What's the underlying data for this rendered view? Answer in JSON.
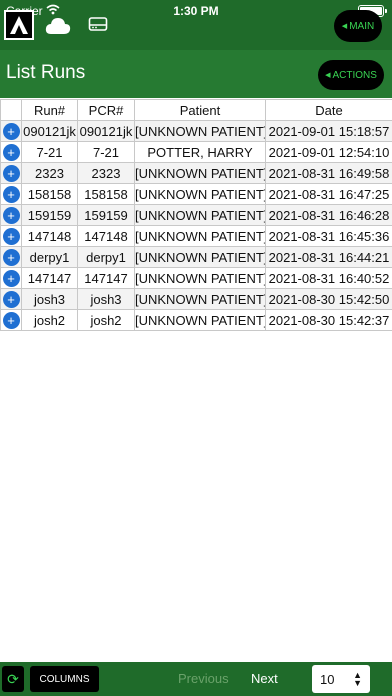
{
  "status_bar": {
    "carrier": "Carrier",
    "time": "1:30 PM"
  },
  "top_bar": {
    "main_label": "MAIN"
  },
  "page": {
    "title": "List Runs",
    "actions_label": "ACTIONS"
  },
  "table": {
    "headers": [
      "",
      "Run#",
      "PCR#",
      "Patient",
      "Date"
    ],
    "rows": [
      {
        "run": "090121jk",
        "pcr": "090121jk",
        "patient": "[UNKNOWN PATIENT]",
        "date": "2021-09-01 15:18:57"
      },
      {
        "run": "7-21",
        "pcr": "7-21",
        "patient": "POTTER, HARRY",
        "date": "2021-09-01 12:54:10"
      },
      {
        "run": "2323",
        "pcr": "2323",
        "patient": "[UNKNOWN PATIENT]",
        "date": "2021-08-31 16:49:58"
      },
      {
        "run": "158158",
        "pcr": "158158",
        "patient": "[UNKNOWN PATIENT]",
        "date": "2021-08-31 16:47:25"
      },
      {
        "run": "159159",
        "pcr": "159159",
        "patient": "[UNKNOWN PATIENT]",
        "date": "2021-08-31 16:46:28"
      },
      {
        "run": "147148",
        "pcr": "147148",
        "patient": "[UNKNOWN PATIENT]",
        "date": "2021-08-31 16:45:36"
      },
      {
        "run": "derpy1",
        "pcr": "derpy1",
        "patient": "[UNKNOWN PATIENT]",
        "date": "2021-08-31 16:44:21"
      },
      {
        "run": "147147",
        "pcr": "147147",
        "patient": "[UNKNOWN PATIENT]",
        "date": "2021-08-31 16:40:52"
      },
      {
        "run": "josh3",
        "pcr": "josh3",
        "patient": "[UNKNOWN PATIENT]",
        "date": "2021-08-30 15:42:50"
      },
      {
        "run": "josh2",
        "pcr": "josh2",
        "patient": "[UNKNOWN PATIENT]",
        "date": "2021-08-30 15:42:37"
      }
    ]
  },
  "footer": {
    "columns_label": "COLUMNS",
    "previous_label": "Previous",
    "next_label": "Next",
    "page_size": "10"
  },
  "icons": {
    "logo": "app-logo-icon",
    "cloud": "cloud-sync-icon",
    "drive": "drive-icon",
    "expand": "expand-plus-icon",
    "refresh": "refresh-icon"
  },
  "colors": {
    "top_bar": "#1f6b2a",
    "header": "#267a32",
    "accent": "#39d353",
    "expand_button": "#1f6fd2"
  }
}
